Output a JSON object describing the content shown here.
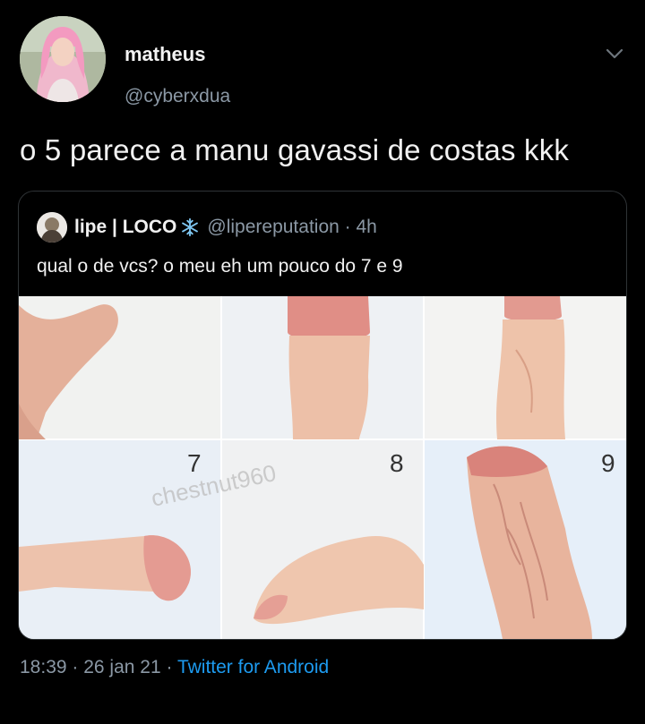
{
  "author": {
    "display_name": "matheus",
    "handle": "@cyberxdua"
  },
  "tweet": {
    "text": "o 5 parece a manu gavassi de costas kkk"
  },
  "quoted": {
    "display_name": "lipe | LOCO",
    "handle": "@lipereputation",
    "separator": " · ",
    "time": "4h",
    "text": "qual o de vcs? o meu eh um pouco do 7 e 9",
    "image": {
      "labels": [
        "7",
        "8",
        "9"
      ],
      "watermark": "chestnut960"
    }
  },
  "meta": {
    "time": "18:39",
    "sep1": " · ",
    "date": "26 jan 21",
    "sep2": " · ",
    "source": "Twitter for Android"
  },
  "colors": {
    "background": "#000000",
    "muted": "#8b98a5",
    "link": "#1d9bf0",
    "border": "#2f3336"
  }
}
